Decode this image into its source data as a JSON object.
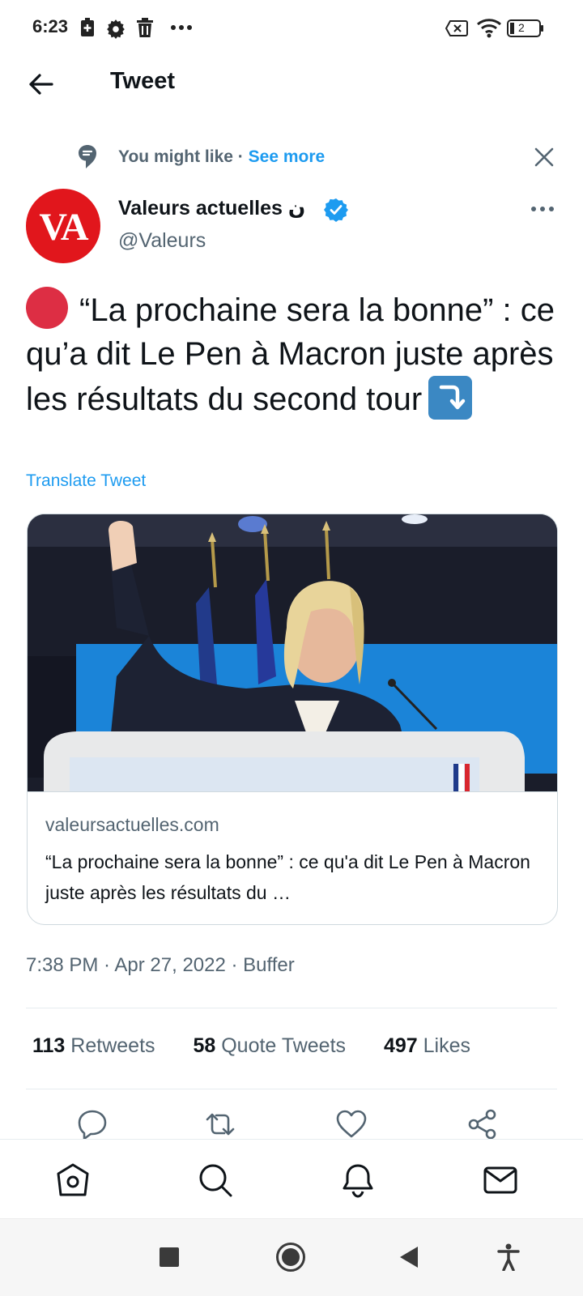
{
  "status_bar": {
    "time": "6:23",
    "battery_level": "2",
    "icons": [
      "battery-saver-icon",
      "settings-icon",
      "trash-icon",
      "more-dots-icon",
      "screen-x-icon",
      "wifi-icon",
      "battery-icon"
    ]
  },
  "header": {
    "title": "Tweet",
    "back_icon": "back-arrow-icon"
  },
  "suggestion": {
    "label": "You might like",
    "separator": " · ",
    "see_more": "See more",
    "close_icon": "close-icon"
  },
  "author": {
    "avatar_text": "VA",
    "name": "Valeurs actuelles ن",
    "handle": "@Valeurs",
    "verified": true,
    "avatar_color": "#e1161c"
  },
  "tweet": {
    "text": "“La prochaine sera la bonne” : ce qu’a dit Le Pen à Macron juste après les résultats du second tour",
    "translate_label": "Translate Tweet"
  },
  "card": {
    "domain": "valeursactuelles.com",
    "title": "“La prochaine sera la bonne” : ce qu'a dit Le Pen à Macron juste après les résultats du …"
  },
  "meta": {
    "time": "7:38 PM",
    "date": "Apr 27, 2022",
    "source": "Buffer",
    "separator": " · "
  },
  "stats": {
    "retweets_count": "113",
    "retweets_label": "Retweets",
    "quotes_count": "58",
    "quotes_label": "Quote Tweets",
    "likes_count": "497",
    "likes_label": "Likes"
  },
  "actions": [
    "reply-icon",
    "retweet-icon",
    "like-icon",
    "share-icon"
  ],
  "bottom_nav": [
    "home-icon",
    "search-icon",
    "notifications-icon",
    "messages-icon"
  ],
  "system_nav": [
    "recents-icon",
    "home-circle-icon",
    "back-triangle-icon",
    "accessibility-icon"
  ],
  "colors": {
    "accent": "#1d9bf0",
    "text_primary": "#0f1419",
    "text_secondary": "#536471",
    "border": "#cfd9de"
  }
}
